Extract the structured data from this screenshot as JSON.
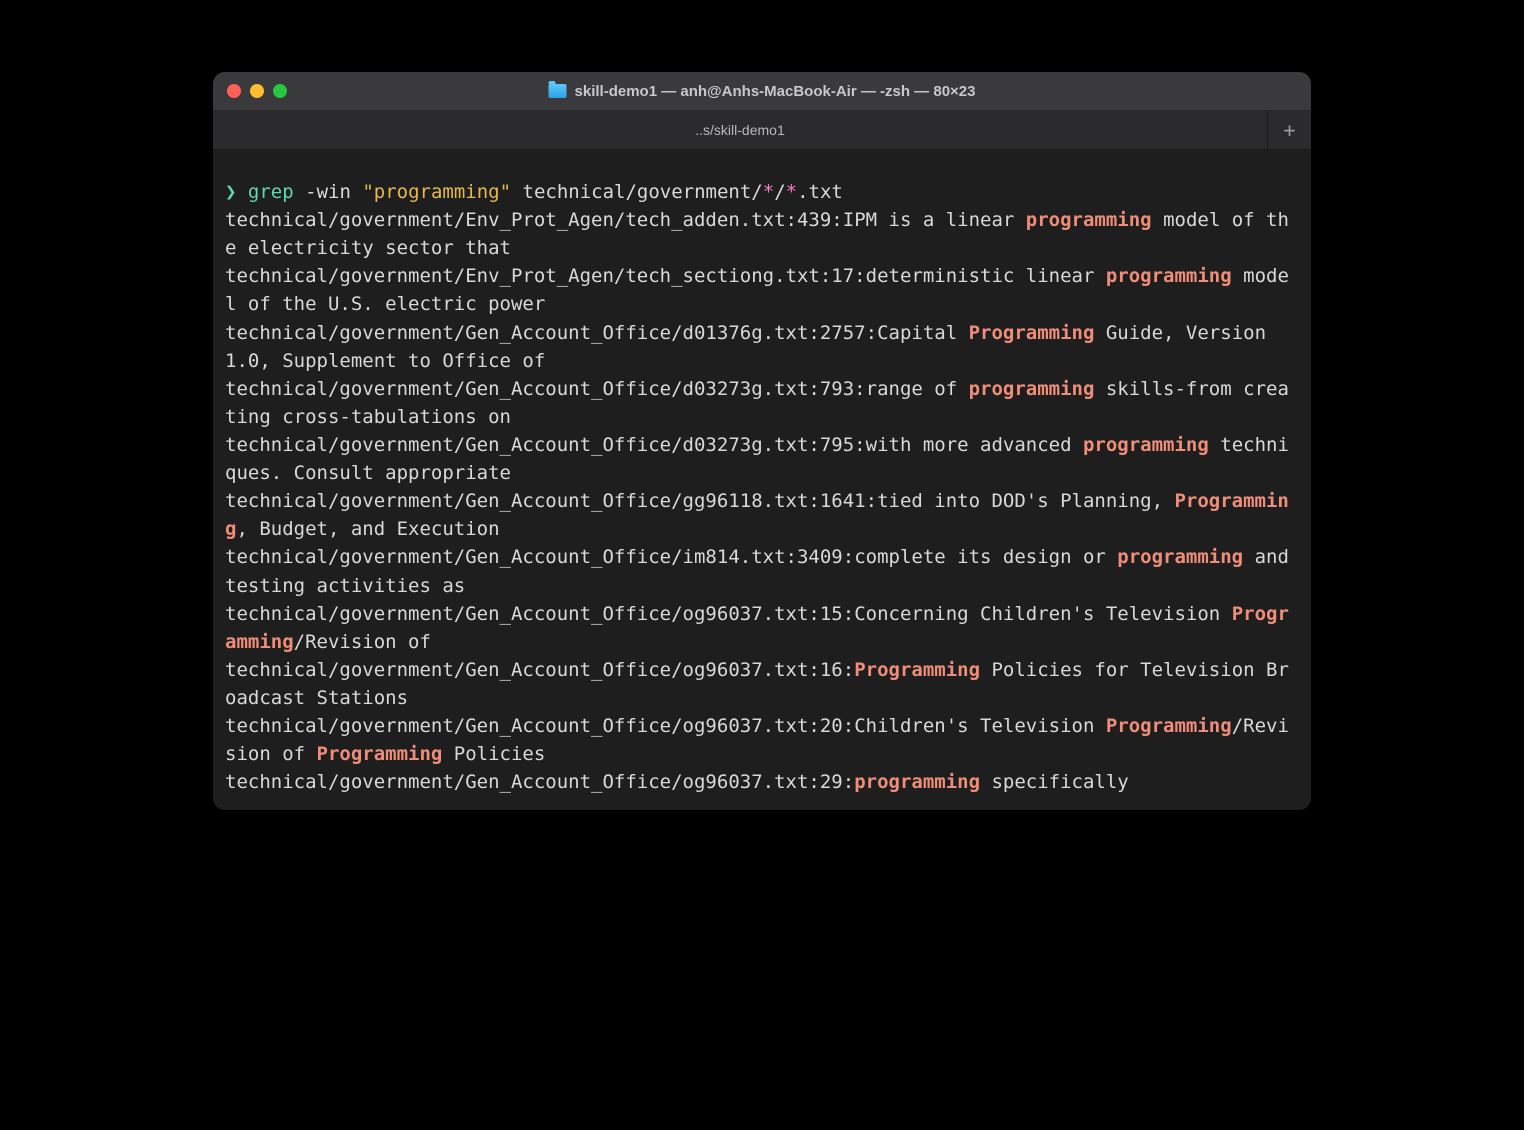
{
  "window": {
    "title": "skill-demo1 — anh@Anhs-MacBook-Air — -zsh — 80×23",
    "tab_label": "..s/skill-demo1",
    "new_tab_glyph": "+"
  },
  "prompt": {
    "symbol": "❯",
    "command": "grep",
    "flags": "-win",
    "arg_quoted": "\"programming\"",
    "path_prefix": "technical/government/",
    "glob1": "*",
    "sep": "/",
    "glob2": "*",
    "ext": ".txt"
  },
  "grep_results": [
    {
      "file": "technical/government/Env_Prot_Agen/tech_adden.txt",
      "line": 439,
      "segments": [
        {
          "t": "IPM is a linear ",
          "hl": false
        },
        {
          "t": "programming",
          "hl": true
        },
        {
          "t": " model of the electricity sector that",
          "hl": false
        }
      ]
    },
    {
      "file": "technical/government/Env_Prot_Agen/tech_sectiong.txt",
      "line": 17,
      "segments": [
        {
          "t": "deterministic linear ",
          "hl": false
        },
        {
          "t": "programming",
          "hl": true
        },
        {
          "t": " model of the U.S. electric power",
          "hl": false
        }
      ]
    },
    {
      "file": "technical/government/Gen_Account_Office/d01376g.txt",
      "line": 2757,
      "segments": [
        {
          "t": "Capital ",
          "hl": false
        },
        {
          "t": "Programming",
          "hl": true
        },
        {
          "t": " Guide, Version 1.0, Supplement to Office of",
          "hl": false
        }
      ]
    },
    {
      "file": "technical/government/Gen_Account_Office/d03273g.txt",
      "line": 793,
      "segments": [
        {
          "t": "range of ",
          "hl": false
        },
        {
          "t": "programming",
          "hl": true
        },
        {
          "t": " skills-from creating cross-tabulations on",
          "hl": false
        }
      ]
    },
    {
      "file": "technical/government/Gen_Account_Office/d03273g.txt",
      "line": 795,
      "segments": [
        {
          "t": "with more advanced ",
          "hl": false
        },
        {
          "t": "programming",
          "hl": true
        },
        {
          "t": " techniques. Consult appropriate",
          "hl": false
        }
      ]
    },
    {
      "file": "technical/government/Gen_Account_Office/gg96118.txt",
      "line": 1641,
      "segments": [
        {
          "t": "tied into DOD's Planning, ",
          "hl": false
        },
        {
          "t": "Programming",
          "hl": true
        },
        {
          "t": ", Budget, and Execution",
          "hl": false
        }
      ]
    },
    {
      "file": "technical/government/Gen_Account_Office/im814.txt",
      "line": 3409,
      "segments": [
        {
          "t": "complete its design or ",
          "hl": false
        },
        {
          "t": "programming",
          "hl": true
        },
        {
          "t": " and testing activities as",
          "hl": false
        }
      ]
    },
    {
      "file": "technical/government/Gen_Account_Office/og96037.txt",
      "line": 15,
      "segments": [
        {
          "t": "Concerning Children's Television ",
          "hl": false
        },
        {
          "t": "Programming",
          "hl": true
        },
        {
          "t": "/Revision of",
          "hl": false
        }
      ]
    },
    {
      "file": "technical/government/Gen_Account_Office/og96037.txt",
      "line": 16,
      "segments": [
        {
          "t": "Programming",
          "hl": true
        },
        {
          "t": " Policies for Television Broadcast Stations",
          "hl": false
        }
      ]
    },
    {
      "file": "technical/government/Gen_Account_Office/og96037.txt",
      "line": 20,
      "segments": [
        {
          "t": "Children's Television ",
          "hl": false
        },
        {
          "t": "Programming",
          "hl": true
        },
        {
          "t": "/Revision of ",
          "hl": false
        },
        {
          "t": "Programming",
          "hl": true
        },
        {
          "t": " Policies",
          "hl": false
        }
      ]
    },
    {
      "file": "technical/government/Gen_Account_Office/og96037.txt",
      "line": 29,
      "segments": [
        {
          "t": "programming",
          "hl": true
        },
        {
          "t": " specifically",
          "hl": false
        }
      ]
    }
  ]
}
